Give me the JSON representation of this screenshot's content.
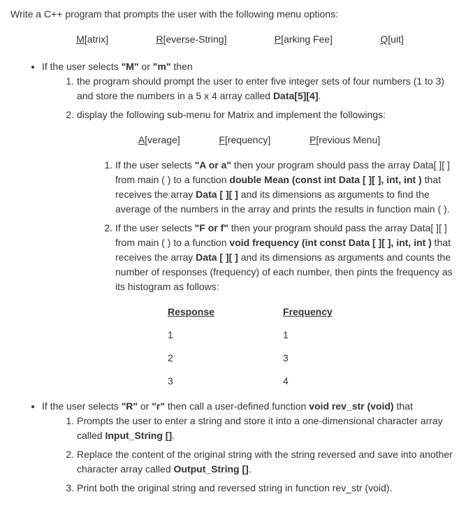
{
  "intro": "Write a C++ program that prompts the user with the following menu options:",
  "menu": {
    "m": {
      "first": "M",
      "rest": "[atrix]"
    },
    "r": {
      "first": "R",
      "rest": "[everse-String]"
    },
    "p": {
      "first": "P",
      "rest": "[arking Fee]"
    },
    "q": {
      "first": "Q",
      "rest": "[uit]"
    }
  },
  "bullet1": {
    "text_a": "If the user selects ",
    "text_b": "\"M\"",
    "text_c": " or ",
    "text_d": "\"m\"",
    "text_e": " then",
    "step1_a": "the program should prompt the user to enter five integer sets of four numbers (1 to 3) and store the numbers in a 5 x 4 array called ",
    "step1_b": "Data[5][4]",
    "step1_c": ".",
    "step2": "display the following sub-menu for Matrix and implement the followings:"
  },
  "submenu": {
    "a": {
      "first": "A",
      "rest": "[verage]"
    },
    "f": {
      "first": "F",
      "rest": "[requency]"
    },
    "p": {
      "first": "P",
      "rest": "[revious Menu]"
    }
  },
  "sub1": {
    "a": "If the user selects ",
    "b": "\"A or a\"",
    "c": " then your program should pass the array Data[ ][ ] from main ( ) to a function ",
    "d": "double Mean (const int Data [ ][ ], int, int )",
    "e": " that receives the array ",
    "f": "Data [ ][ ]",
    "g": " and its dimensions as arguments to find the average of the numbers in the array and prints the results in function main ( )."
  },
  "sub2": {
    "a": "If the user selects ",
    "b": "\"F or f\"",
    "c": " then your program should pass the array Data[ ][ ] from main ( ) to a function ",
    "d": "void frequency (int const Data [ ][ ], int, int )",
    "e": " that receives the array ",
    "f": "Data [ ][ ]",
    "g": " and its dimensions as arguments and counts the number of responses (frequency) of each number, then pints the frequency as its histogram as follows:"
  },
  "table": {
    "h1": "Response",
    "h2": "Frequency",
    "rows": [
      {
        "r": "1",
        "f": "1"
      },
      {
        "r": "2",
        "f": "3"
      },
      {
        "r": "3",
        "f": "4"
      }
    ]
  },
  "bullet2": {
    "a": "If the user selects ",
    "b": "\"R\"",
    "c": " or ",
    "d": "\"r\"",
    "e": " then call a user-defined function ",
    "f": "void rev_str (void)",
    "g": " that",
    "s1a": "Prompts the user to enter a string and store it into a one-dimensional character array called ",
    "s1b": "Input_String []",
    "s1c": ".",
    "s2a": "Replace the content of the original string with the string reversed and save into another character array called ",
    "s2b": "Output_String []",
    "s2c": ".",
    "s3": "Print both the original string and reversed string in function rev_str (void)."
  }
}
